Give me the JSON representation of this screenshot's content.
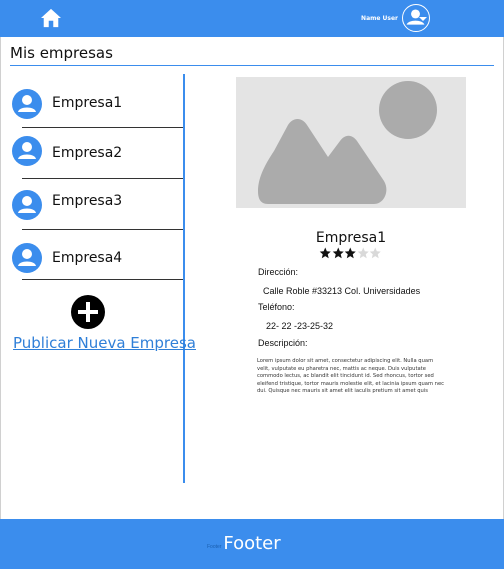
{
  "header": {
    "home_icon": "home-icon",
    "user_name": "Name User",
    "user_icon": "user-circle-icon",
    "caret_icon": "caret-down-icon",
    "bar_color": "#3b8ded"
  },
  "page": {
    "title": "Mis empresas"
  },
  "companies": [
    {
      "label": "Empresa1",
      "icon": "user-circle-icon"
    },
    {
      "label": "Empresa2",
      "icon": "user-circle-icon"
    },
    {
      "label": "Empresa3",
      "icon": "user-circle-icon"
    },
    {
      "label": "Empresa4",
      "icon": "user-circle-icon"
    }
  ],
  "actions": {
    "add_icon": "plus-circle-icon",
    "add_link": "Publicar Nueva Empresa"
  },
  "detail": {
    "image_icon": "image-placeholder-icon",
    "name": "Empresa1",
    "rating": 3,
    "rating_max": 5,
    "address_label": "Dirección:",
    "address": "Calle Roble #33213 Col. Universidades",
    "phone_label": "Teléfono:",
    "phone": "22- 22 -23-25-32",
    "description_label": "Descripción:",
    "description": "Lorem ipsum dolor sit amet, consectetur adipiscing elit. Nulla quam velit, vulputate eu pharetra nec, mattis ac neque. Duis vulputate commodo lectus, ac blandit elit tincidunt id. Sed rhoncus, tortor sed eleifend tristique, tortor mauris molestie elit, et lacinia ipsum quam nec dui. Quisque nec mauris sit amet elit iaculis pretium sit amet quis"
  },
  "footer": {
    "label": "Footer",
    "ghost_text": "Footer"
  }
}
